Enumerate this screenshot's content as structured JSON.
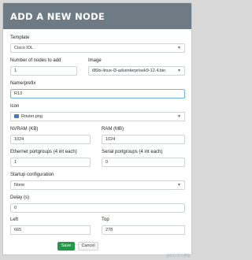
{
  "header": {
    "title": "ADD A NEW NODE"
  },
  "template": {
    "label": "Template",
    "value": "Cisco IOL"
  },
  "nodes_count": {
    "label": "Number of nodes to add",
    "value": "1"
  },
  "image": {
    "label": "Image",
    "value": "i86bi-linux-l3-adventerprisek9-12.4.bin"
  },
  "name_prefix": {
    "label": "Name/prefix",
    "value": "R13"
  },
  "icon": {
    "label": "Icon",
    "value": "Router.png"
  },
  "nvram": {
    "label": "NVRAM (KB)",
    "value": "1024"
  },
  "ram": {
    "label": "RAM (MB)",
    "value": "1024"
  },
  "ethernet": {
    "label": "Ethernet portgroups (4 int each)",
    "value": "1"
  },
  "serial": {
    "label": "Serial portgroups (4 int each)",
    "value": "0"
  },
  "startup": {
    "label": "Startup configuration",
    "value": "None"
  },
  "delay": {
    "label": "Delay (s)",
    "value": "0"
  },
  "left": {
    "label": "Left",
    "value": "665"
  },
  "top": {
    "label": "Top",
    "value": "278"
  },
  "buttons": {
    "save": "Save",
    "cancel": "Cancel"
  },
  "watermark": "@51CTO博客"
}
